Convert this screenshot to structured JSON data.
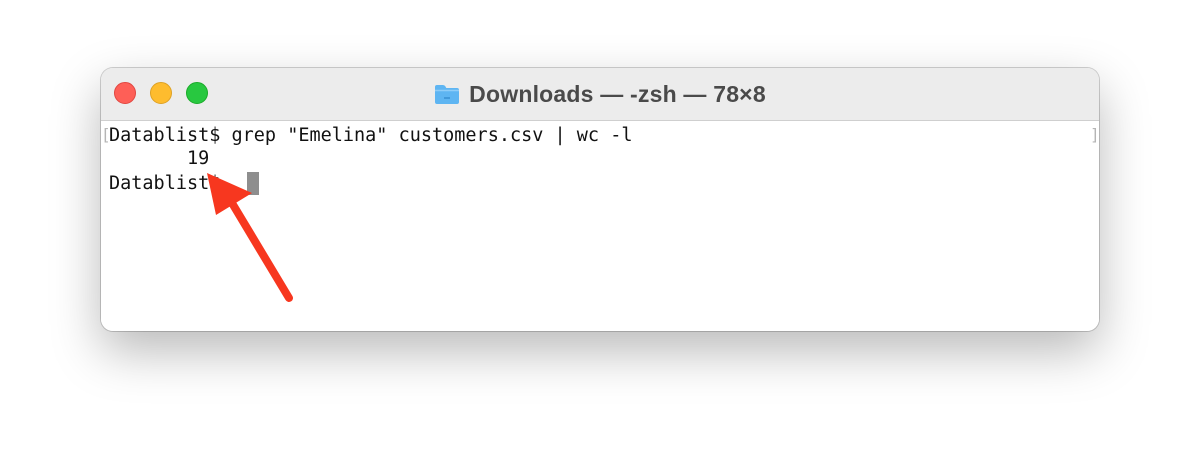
{
  "window": {
    "title": "Downloads — -zsh — 78×8"
  },
  "terminal": {
    "left_bracket": "[",
    "right_bracket": "]",
    "lines": [
      "Datablist$ grep \"Emelina\" customers.csv | wc -l",
      "       19",
      "Datablist$ "
    ]
  },
  "colors": {
    "close": "#fe5f57",
    "minimize": "#febc2e",
    "zoom": "#28c840",
    "folder": "#5eb5f2",
    "annotation_arrow": "#f7371f"
  },
  "icons": {
    "folder": "folder-icon"
  }
}
